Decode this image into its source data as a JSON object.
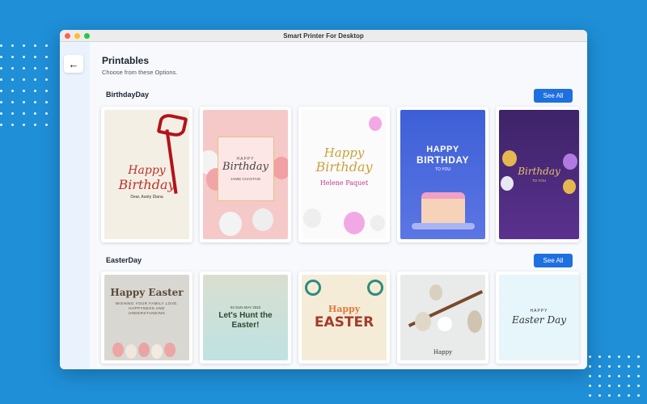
{
  "window": {
    "title": "Smart Printer For Desktop"
  },
  "page": {
    "title": "Printables",
    "subtitle": "Choose from these Options."
  },
  "sections": [
    {
      "title": "BirthdayDay",
      "see_all": "See All",
      "cards": [
        {
          "line1": "Happy",
          "line2": "Birthday",
          "detail": "Dear, Aunty Diana"
        },
        {
          "small": "HAPPY",
          "line1": "Birthday",
          "detail": "JAMIE CHASTAIN"
        },
        {
          "line1": "Happy",
          "line2": "Birthday",
          "detail": "Helene Paquet"
        },
        {
          "line1": "HAPPY",
          "line2": "BIRTHDAY",
          "detail": "TO YOU"
        },
        {
          "line1": "Birthday",
          "detail": "TO YOU"
        }
      ]
    },
    {
      "title": "EasterDay",
      "see_all": "See All",
      "cards": [
        {
          "line1": "Happy Easter",
          "detail": "WISHING YOUR FAMILY LOVE, HAPPYNESS AND UNDERSTANDING"
        },
        {
          "small": "04 SUN MAY 2022",
          "line1": "Let's Hunt the Easter!"
        },
        {
          "line1": "Happy",
          "line2": "EASTER"
        },
        {
          "line1": "Happy"
        },
        {
          "small": "HAPPY",
          "line1": "Easter Day"
        }
      ]
    }
  ],
  "icons": {
    "back": "arrow-left-icon"
  },
  "colors": {
    "accent": "#1e6fe0",
    "background": "#1f8fd8"
  }
}
